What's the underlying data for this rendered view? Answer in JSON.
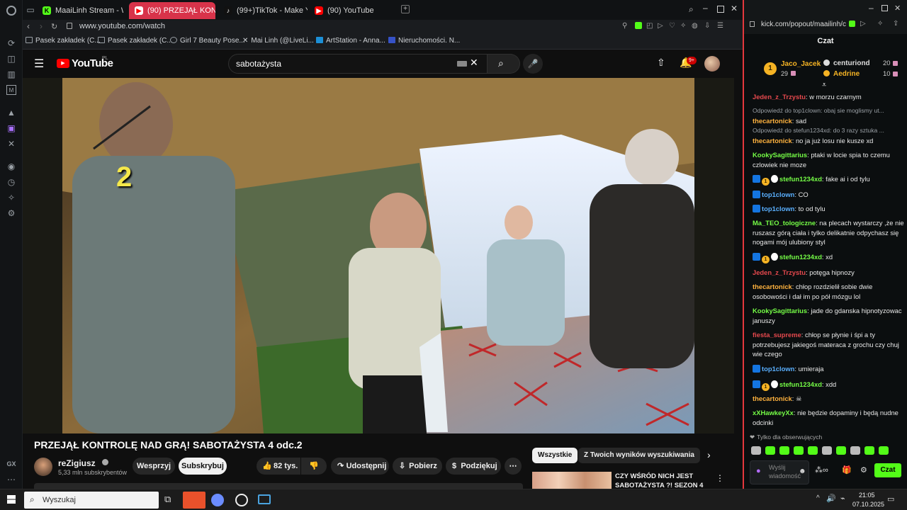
{
  "colors": {
    "accent_green": "#53fc18",
    "yt_red": "#ff0000",
    "gx_red": "#e4383d",
    "chat_bg": "#0b0e0f"
  },
  "browser": {
    "tabs": [
      {
        "label": "MaaiLinh Stream - Watch",
        "icon": "kick-icon",
        "color": "#53fc18",
        "letter": "K"
      },
      {
        "label": "(90) PRZEJĄŁ KONTRO",
        "icon": "youtube-icon",
        "color": "#ff0000",
        "letter": "▶"
      },
      {
        "label": "(99+)TikTok - Make Your",
        "icon": "tiktok-icon",
        "color": "#111111",
        "letter": "♪"
      },
      {
        "label": "(90) YouTube",
        "icon": "youtube-icon",
        "color": "#ff0000",
        "letter": "▶"
      }
    ],
    "url": "www.youtube.com/watch",
    "bookmarks": [
      "Pasek zakładek (C...",
      "Pasek zakładek (C...",
      "Girl 7 Beauty Pose...",
      "Mai Linh (@LiveLi...",
      "ArtStation - Anna...",
      "Nieruchomości. N..."
    ],
    "gx_label": "GX"
  },
  "youtube": {
    "logo": "YouTube",
    "logo_region": "PL",
    "search_value": "sabotażysta",
    "notifications": "9+",
    "video_overlay_number": "2",
    "title": "PRZEJĄŁ KONTROLĘ NAD GRĄ! SABOTAŻYSTA 4 odc.2",
    "channel": {
      "name": "reZigiusz",
      "subscribers": "5,33 mln subskrybentów"
    },
    "buttons": {
      "support": "Wesprzyj",
      "subscribe": "Subskrybuj",
      "likes": "82 tys.",
      "share": "Udostępnij",
      "download": "Pobierz",
      "thanks": "Podziękuj"
    },
    "chips": [
      "Wszystkie",
      "Z Twoich wyników wyszukiwania"
    ],
    "suggested_title": "CZY WŚRÓD NICH JEST SABOTAŻYSTA ?! SEZON 4"
  },
  "chat": {
    "url": "kick.com/popout/maailinh/c",
    "header": "Czat",
    "leaderboard": [
      {
        "rank": "1",
        "name": "Jaco_Jacek",
        "count": "29"
      },
      {
        "name": "centuriond",
        "count": "20"
      },
      {
        "name": "Aedrine",
        "count": "10"
      }
    ],
    "messages": [
      {
        "user": "Jeden_z_Trzystu",
        "color": "#e5484d",
        "text": ": w morzu czarnym"
      },
      {
        "reply": "Odpowiedź do top1clown: obaj sie moglismy ut...",
        "user": "thecartonick",
        "color": "#ffb23e",
        "text": ": sad"
      },
      {
        "reply": "Odpowiedź do stefun1234xd: do 3 razy sztuka ...",
        "user": "thecartonick",
        "color": "#ffb23e",
        "text": ": no ja już losu nie kusze xd"
      },
      {
        "user": "KookySagittarius",
        "color": "#75fd46",
        "text": ": ptaki w locie spia to czemu czlowiek nie moze"
      },
      {
        "badges": true,
        "user": "stefun1234xd",
        "color": "#75fd46",
        "text": ": fake ai i od tylu"
      },
      {
        "verified": true,
        "user": "top1clown",
        "color": "#5ab0ff",
        "text": ": CO"
      },
      {
        "verified": true,
        "user": "top1clown",
        "color": "#5ab0ff",
        "text": ": to od tylu"
      },
      {
        "user": "Ma_TEO_tologiczne",
        "color": "#75fd46",
        "text": ": na plecach wystarczy ,że nie ruszasz górą ciała i tylko delikatnie odpychasz się nogami mój ulubiony styl"
      },
      {
        "badges": true,
        "user": "stefun1234xd",
        "color": "#75fd46",
        "text": ": xd"
      },
      {
        "user": "Jeden_z_Trzystu",
        "color": "#e5484d",
        "text": ": potęga hipnozy"
      },
      {
        "user": "thecartonick",
        "color": "#ffb23e",
        "text": ": chłop rozdzielił sobie dwie osobowości i dał im po pół mózgu lol"
      },
      {
        "user": "KookySagittarius",
        "color": "#75fd46",
        "text": ": jade do gdanska hipnotyzowac januszy"
      },
      {
        "user": "fiesta_supreme",
        "color": "#e5484d",
        "text": ": chłop se płynie i śpi a ty potrzebujesz jakiegoś materaca z grochu czy chuj wie czego"
      },
      {
        "verified": true,
        "user": "top1clown",
        "color": "#5ab0ff",
        "text": ": umieraja"
      },
      {
        "badges": true,
        "user": "stefun1234xd",
        "color": "#75fd46",
        "text": ": xdd"
      },
      {
        "user": "thecartonick",
        "color": "#ffb23e",
        "text": ": ☠"
      },
      {
        "user": "xXHawkeyXx",
        "color": "#75fd46",
        "text": ": nie będzie dopaminy i będą nudne odcinki"
      }
    ],
    "followers_only": "Tylko dla obserwujących",
    "input_placeholder": "Wyślij wiadomość",
    "send": "Czat",
    "badge_count": "1"
  },
  "taskbar": {
    "search": "Wyszukaj",
    "time": "21:05",
    "date": "07.10.2025"
  }
}
